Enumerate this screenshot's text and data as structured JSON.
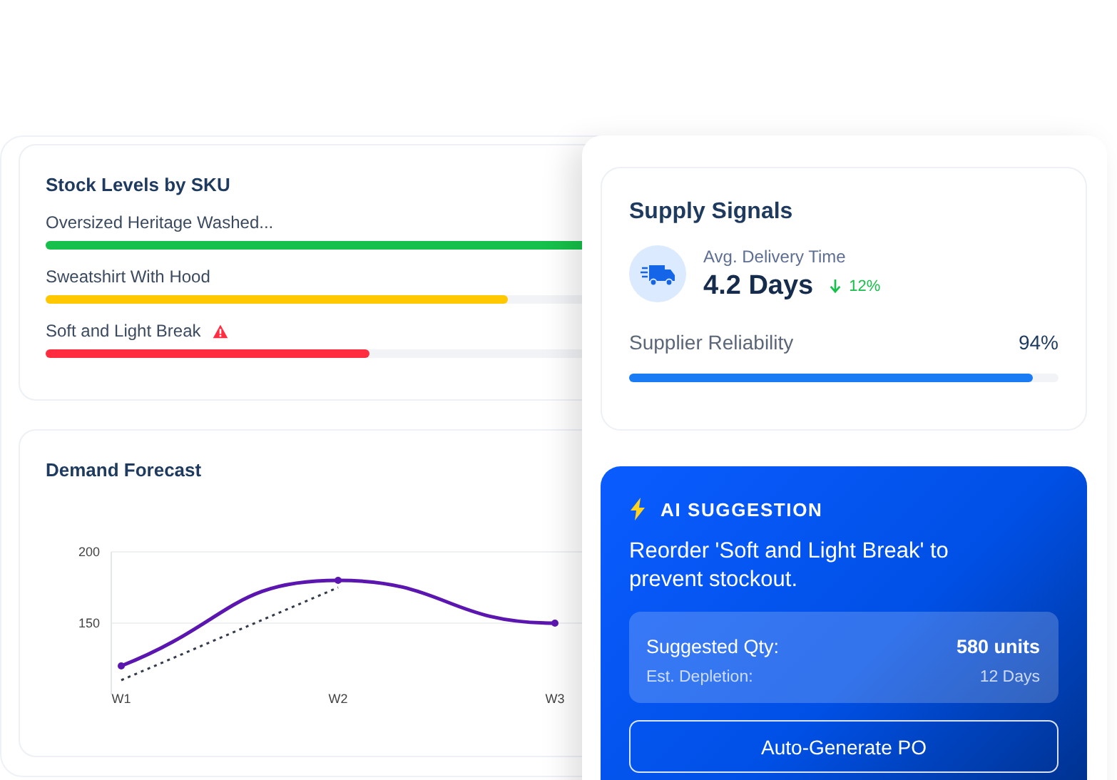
{
  "stock_levels": {
    "title": "Stock Levels by SKU",
    "items": [
      {
        "name": "Oversized Heritage Washed...",
        "level": 0.85,
        "color": "#16c04a",
        "warning": false
      },
      {
        "name": "Sweatshirt With Hood",
        "level": 0.6,
        "color": "#ffc800",
        "warning": false
      },
      {
        "name": "Soft and Light Break",
        "level": 0.42,
        "color": "#ff2d3f",
        "warning": true
      }
    ]
  },
  "demand_forecast": {
    "title": "Demand Forecast",
    "chart_data": {
      "type": "line",
      "categories": [
        "W1",
        "W2",
        "W3"
      ],
      "yticks": [
        {
          "value": 150,
          "label": "150"
        },
        {
          "value": 200,
          "label": "200"
        }
      ],
      "ylim": [
        100,
        200
      ],
      "series": [
        {
          "color": "#5b16b0",
          "line_style": "solid",
          "marker": "circle",
          "values": [
            120,
            180,
            150
          ]
        },
        {
          "color": "#333a4a",
          "line_style": "dashed",
          "values": [
            110,
            175,
            null
          ]
        }
      ]
    }
  },
  "supply_signals": {
    "title": "Supply Signals",
    "delivery": {
      "label": "Avg. Delivery Time",
      "value": "4.2 Days",
      "change": "12%"
    },
    "reliability": {
      "label": "Supplier Reliability",
      "value": "94%",
      "level": 0.94
    }
  },
  "ai_suggestion": {
    "title": "AI SUGGESTION",
    "message": "Reorder 'Soft and Light Break' to prevent stockout.",
    "details": [
      {
        "label": "Suggested Qty:",
        "value": "580 units",
        "kind": "primary"
      },
      {
        "label": "Est. Depletion:",
        "value": "12 Days",
        "kind": "secondary"
      }
    ],
    "button": "Auto-Generate PO"
  }
}
